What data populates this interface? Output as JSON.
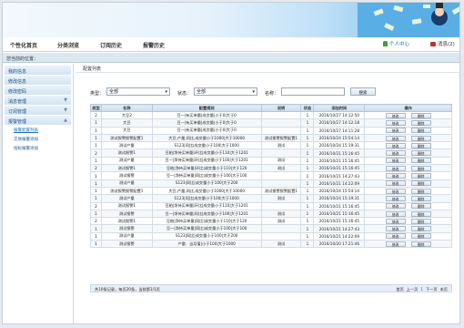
{
  "nav": {
    "items": [
      "个性化首页",
      "分类浏览",
      "订阅历史",
      "报警历史"
    ],
    "user_center": "个人中心",
    "messages": "消息(2)"
  },
  "breadcrumb": "您当前的位置：",
  "sidebar": {
    "items": [
      {
        "label": "我的信息"
      },
      {
        "label": "修改信息"
      },
      {
        "label": "修改密码"
      },
      {
        "label": "消息管理"
      },
      {
        "label": "订阅管理"
      },
      {
        "label": "报警管理"
      }
    ],
    "subitems": [
      "报警配置列表",
      "交易报警添加",
      "指标报警添加"
    ]
  },
  "main": {
    "title": "配置列表",
    "filter": {
      "type_label": "类型：",
      "type_value": "全部",
      "status_label": "状态：",
      "status_value": "全部",
      "name_label": "名称：",
      "search_label": "搜索"
    },
    "table": {
      "headers": [
        "类型",
        "名称",
        "配置规则",
        "说明",
        "状态",
        "添加时间",
        "操作"
      ],
      "edit_label": "修改",
      "delete_label": "删除",
      "rows": [
        [
          "2",
          "大豆2",
          "豆一|有买单量|成交量|小于0|大于0",
          "",
          "1",
          "2016/10/27 14:12:50"
        ],
        [
          "1",
          "大豆",
          "豆一|有买单量|成交量|小于0|大于0",
          "",
          "1",
          "2016/10/27 14:12:18"
        ],
        [
          "1",
          "大豆",
          "豆一|有买单量|成交量|小于0|大于0",
          "",
          "1",
          "2016/10/27 14:11:28"
        ],
        [
          "1",
          "测试报警报警配置1",
          "大豆,产量,同比,成交量小于1000|大于10000",
          "测试报警报警配置1",
          "1",
          "2016/10/24 15:54:14"
        ],
        [
          "1",
          "测试产量",
          "S123|同比|成交量小于100|大于1000",
          "测试",
          "1",
          "2016/10/24 15:19:31"
        ],
        [
          "2",
          "测试报警1",
          "豆粕|净持买单量|环比|成交量小于110|大于1201",
          "",
          "1",
          "2016/10/21 15:16:45"
        ],
        [
          "1",
          "测试产量",
          "豆一|净持买单量|环比|成交量小于100|大于1201",
          "测试",
          "1",
          "2016/10/21 15:16:45"
        ],
        [
          "2",
          "测试报警1",
          "豆粕|净持买单量|环比|成交量小于110|大于120",
          "测试",
          "1",
          "2016/10/21 15:16:45"
        ],
        [
          "1",
          "测试报警",
          "豆一|净持买单量|同比|成交量小于100|大于100",
          "",
          "1",
          "2016/10/21 14:27:43"
        ],
        [
          "1",
          "测试产量",
          "S123|同比|成交量小于100|大于200",
          "",
          "1",
          "2016/10/21 14:22:09"
        ],
        [
          "1",
          "测试报警报警配置1",
          "大豆,产量,同比,成交量小于1000|大于10000",
          "测试报警报警配置1",
          "1",
          "2016/10/24 15:54:14"
        ],
        [
          "1",
          "测试产量",
          "S123|同比|成交量小于100|大于1000",
          "测试",
          "1",
          "2016/10/24 15:19:31"
        ],
        [
          "2",
          "测试报警1",
          "豆粕|净持买单量|环比|成交量小于110|大于1201",
          "",
          "1",
          "2016/10/21 15:16:45"
        ],
        [
          "1",
          "测试报警",
          "豆一|净持买单量|同比|成交量小于100|大于1201",
          "测试",
          "1",
          "2016/10/21 15:16:45"
        ],
        [
          "2",
          "测试报警1",
          "豆粕|净持买单量|同比|成交量小于110|大于120",
          "测试",
          "1",
          "2016/10/21 15:16:45"
        ],
        [
          "1",
          "测试报警",
          "豆一|净持买单量|同比|成交量小于100|大于100",
          "",
          "1",
          "2016/10/21 14:27:43"
        ],
        [
          "1",
          "测试产量",
          "S123|同比|成交量小于100|大于200",
          "",
          "1",
          "2016/10/21 14:22:09"
        ],
        [
          "1",
          "测试报警",
          "产量：当月值|小于100|大于1000",
          "测试",
          "1",
          "2016/10/20 17:21:46"
        ]
      ]
    },
    "footer": {
      "summary": "共10条记录，每页20条，当前第1/1页",
      "pager": [
        "首页",
        "上一页",
        "1",
        "下一页",
        "末页"
      ]
    }
  }
}
